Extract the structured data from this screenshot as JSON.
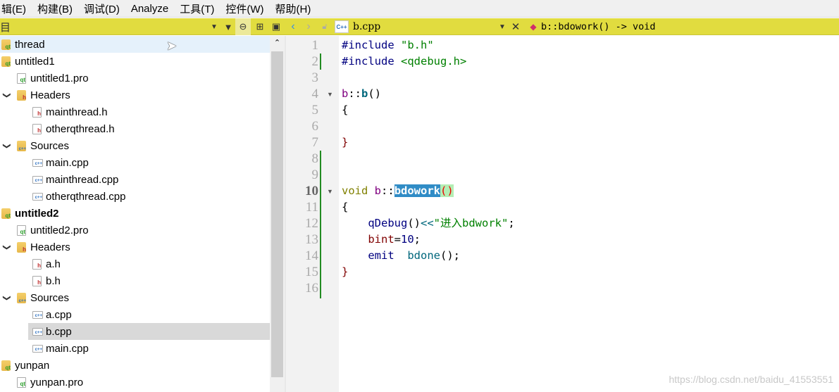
{
  "menu": [
    "辑(E)",
    "构建(B)",
    "调试(D)",
    "Analyze",
    "工具(T)",
    "控件(W)",
    "帮助(H)"
  ],
  "toolbar": {
    "project_label": "目",
    "file_name": "b.cpp",
    "file_icon": "C++",
    "symbol": "b::bdowork() -> void"
  },
  "tree": [
    {
      "label": "thread",
      "type": "project",
      "depth": 0,
      "bold": false,
      "state": "hover"
    },
    {
      "label": "untitled1",
      "type": "project",
      "depth": 0
    },
    {
      "label": "untitled1.pro",
      "type": "pro",
      "depth": 1
    },
    {
      "label": "Headers",
      "type": "folder-h",
      "depth": 1,
      "expanded": true
    },
    {
      "label": "mainthread.h",
      "type": "h",
      "depth": 2
    },
    {
      "label": "otherqthread.h",
      "type": "h",
      "depth": 2
    },
    {
      "label": "Sources",
      "type": "folder-cpp",
      "depth": 1,
      "expanded": true
    },
    {
      "label": "main.cpp",
      "type": "cpp",
      "depth": 2
    },
    {
      "label": "mainthread.cpp",
      "type": "cpp",
      "depth": 2
    },
    {
      "label": "otherqthread.cpp",
      "type": "cpp",
      "depth": 2
    },
    {
      "label": "untitled2",
      "type": "project",
      "depth": 0,
      "bold": true
    },
    {
      "label": "untitled2.pro",
      "type": "pro",
      "depth": 1
    },
    {
      "label": "Headers",
      "type": "folder-h",
      "depth": 1,
      "expanded": true
    },
    {
      "label": "a.h",
      "type": "h",
      "depth": 2
    },
    {
      "label": "b.h",
      "type": "h",
      "depth": 2
    },
    {
      "label": "Sources",
      "type": "folder-cpp",
      "depth": 1,
      "expanded": true
    },
    {
      "label": "a.cpp",
      "type": "cpp",
      "depth": 2
    },
    {
      "label": "b.cpp",
      "type": "cpp",
      "depth": 2,
      "state": "selected"
    },
    {
      "label": "main.cpp",
      "type": "cpp",
      "depth": 2
    },
    {
      "label": "yunpan",
      "type": "project",
      "depth": 0
    },
    {
      "label": "yunpan.pro",
      "type": "pro",
      "depth": 1
    }
  ],
  "editor": {
    "current_line": 10,
    "lines": [
      [
        [
          "pp",
          "#include "
        ],
        [
          "str",
          "\"b.h\""
        ]
      ],
      [
        [
          "pp",
          "#include "
        ],
        [
          "str",
          "<qdebug.h>"
        ]
      ],
      [],
      [
        [
          "cls",
          "b"
        ],
        [
          "plain",
          "::"
        ],
        [
          "bold",
          "b"
        ],
        [
          "plain",
          "()"
        ]
      ],
      [
        [
          "plain",
          "{"
        ]
      ],
      [],
      [
        [
          "var",
          "}"
        ]
      ],
      [],
      [],
      [
        [
          "kw",
          "void "
        ],
        [
          "cls",
          "b"
        ],
        [
          "plain",
          "::"
        ],
        [
          "sel",
          "bdowork"
        ],
        [
          "match",
          "()"
        ]
      ],
      [
        [
          "plain",
          "{"
        ]
      ],
      [
        [
          "plain",
          "    "
        ],
        [
          "pp",
          "qDebug"
        ],
        [
          "plain",
          "()"
        ],
        [
          "fn",
          "<<"
        ],
        [
          "str",
          "\"进入bdwork\""
        ],
        [
          "plain",
          ";"
        ]
      ],
      [
        [
          "plain",
          "    "
        ],
        [
          "var",
          "bint"
        ],
        [
          "plain",
          "="
        ],
        [
          "num",
          "10"
        ],
        [
          "plain",
          ";"
        ]
      ],
      [
        [
          "plain",
          "    "
        ],
        [
          "pp",
          "emit"
        ],
        [
          "plain",
          "  "
        ],
        [
          "fn",
          "bdone"
        ],
        [
          "plain",
          "();"
        ]
      ],
      [
        [
          "var",
          "}"
        ]
      ],
      []
    ]
  },
  "watermark": "https://blog.csdn.net/baidu_41553551"
}
